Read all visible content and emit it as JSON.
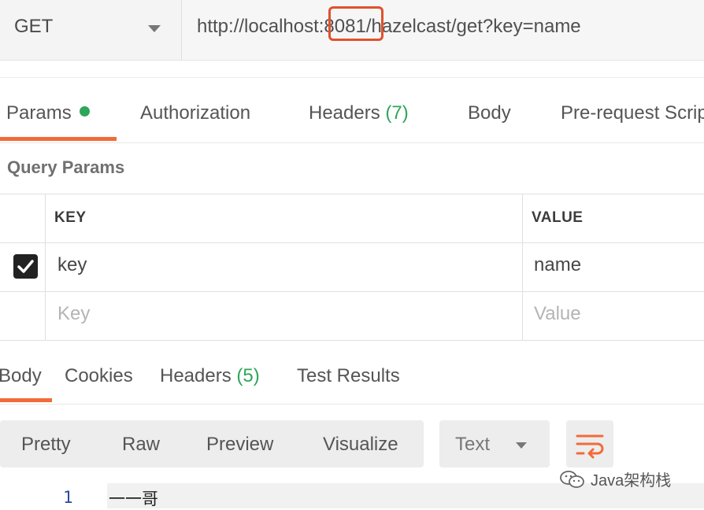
{
  "request": {
    "method": "GET",
    "url": "http://localhost:8081/hazelcast/get?key=name"
  },
  "request_tabs": [
    {
      "label": "Params"
    },
    {
      "label": "Authorization"
    },
    {
      "label": "Headers",
      "count": "(7)"
    },
    {
      "label": "Body"
    },
    {
      "label": "Pre-request Scrip"
    }
  ],
  "query_params": {
    "title": "Query Params",
    "headers": {
      "key": "KEY",
      "value": "VALUE"
    },
    "rows": [
      {
        "checked": true,
        "key": "key",
        "value": "name"
      }
    ],
    "placeholder": {
      "key": "Key",
      "value": "Value"
    }
  },
  "response_tabs": [
    {
      "label": "Body"
    },
    {
      "label": "Cookies"
    },
    {
      "label": "Headers",
      "count": "(5)"
    },
    {
      "label": "Test Results"
    }
  ],
  "format_options": [
    "Pretty",
    "Raw",
    "Preview",
    "Visualize"
  ],
  "language_select": "Text",
  "response_body": {
    "line_number": "1",
    "content": "一一哥"
  },
  "watermark": "Java架构栈",
  "colors": {
    "accent": "#f26b3a",
    "green": "#2ea65a",
    "highlight": "#e0512b"
  }
}
